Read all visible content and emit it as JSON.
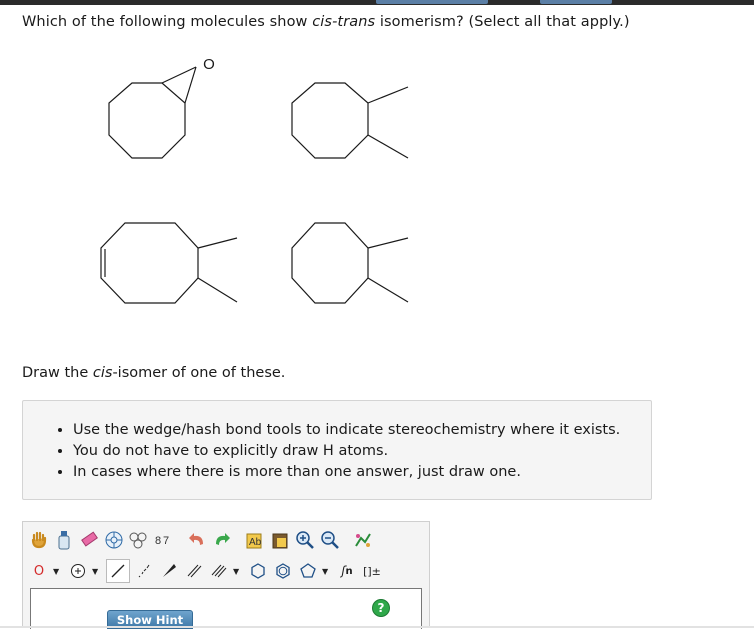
{
  "question": {
    "prefix": "Which of the following molecules show ",
    "italic": "cis-trans",
    "suffix": " isomerism? (Select all that apply.)"
  },
  "molecules": {
    "epoxide_atom_label": "O"
  },
  "draw": {
    "prefix": "Draw the ",
    "italic": "cis",
    "suffix": "-isomer of one of these."
  },
  "instructions": [
    "Use the wedge/hash bond tools to indicate stereochemistry where it exists.",
    "You do not have to explicitly draw H atoms.",
    "In cases where there is more than one answer, just draw one."
  ],
  "editor": {
    "atom_selector": "O",
    "chain_label": "n",
    "bracket_label": "[]±",
    "hint_button": "Show Hint",
    "help_button": "?"
  },
  "colors": {
    "topbar": "#2b2b2b",
    "hint_button": "#4a86b8",
    "help_button": "#2fa84a",
    "atom_red": "#d42a2a"
  }
}
